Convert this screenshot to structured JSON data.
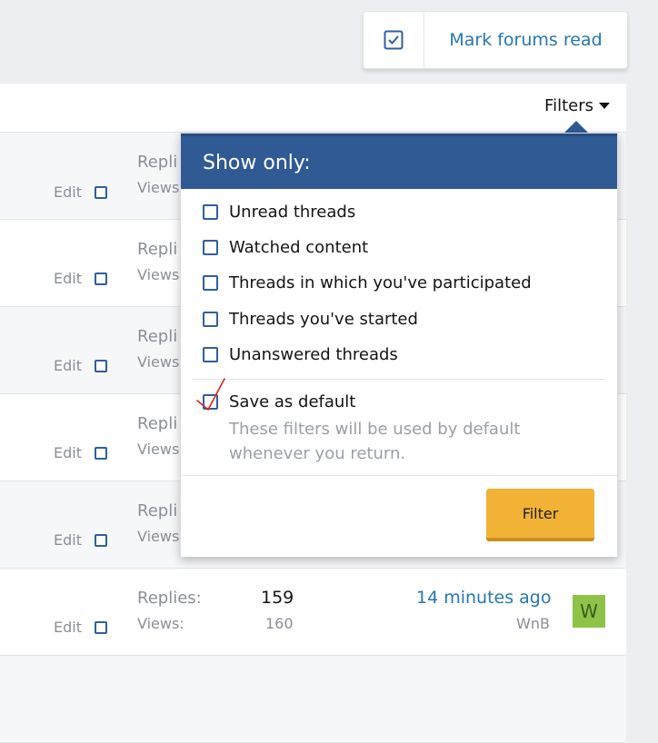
{
  "header": {
    "mark_read_label": "Mark forums read"
  },
  "filters": {
    "label": "Filters"
  },
  "rows": [
    {
      "edit": "Edit",
      "replies_label": "Repli",
      "views_label": "Views"
    },
    {
      "edit": "Edit",
      "replies_label": "Repli",
      "views_label": "Views"
    },
    {
      "edit": "Edit",
      "replies_label": "Repli",
      "views_label": "Views"
    },
    {
      "edit": "Edit",
      "replies_label": "Repli",
      "views_label": "Views"
    },
    {
      "edit": "Edit",
      "replies_label": "Repli",
      "views_label": "Views"
    },
    {
      "edit": "Edit",
      "replies_label": "Replies:",
      "views_label": "Views:",
      "replies": "159",
      "views": "160",
      "last_time": "14 minutes ago",
      "last_user": "WnB",
      "avatar_letter": "W"
    }
  ],
  "menu": {
    "title": "Show only:",
    "options": [
      "Unread threads",
      "Watched content",
      "Threads in which you've participated",
      "Threads you've started",
      "Unanswered threads"
    ],
    "save_default": "Save as default",
    "hint": "These filters will be used by default whenever you return.",
    "button": "Filter"
  },
  "colors": {
    "accent": "#2f5a94",
    "link": "#2577b1",
    "button": "#f1b236"
  }
}
